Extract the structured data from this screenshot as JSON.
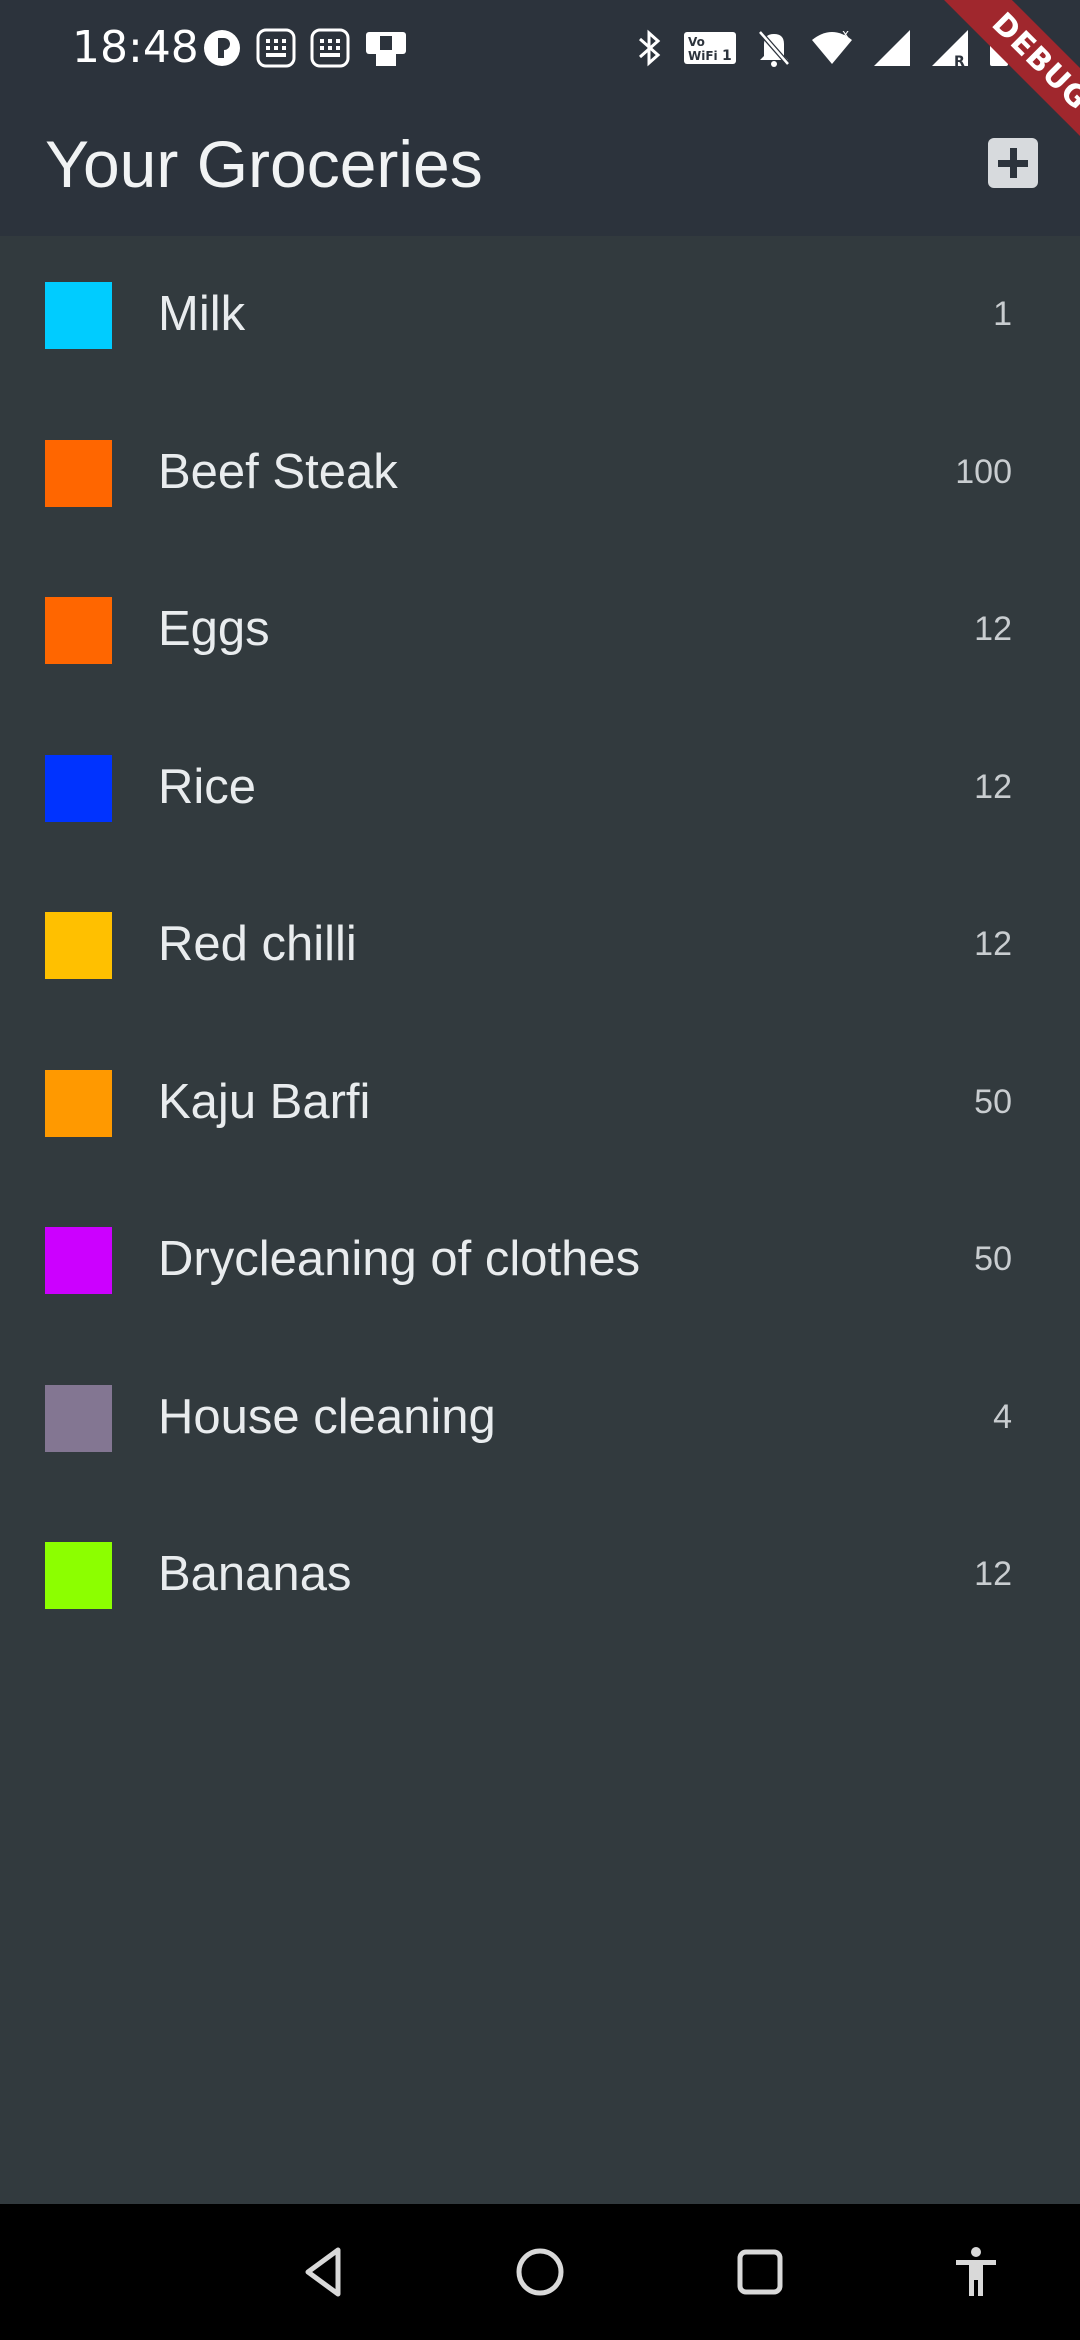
{
  "status_bar": {
    "time": "18:48",
    "left_icons": [
      "app-badge-icon",
      "notification-icon",
      "notification-icon",
      "phone-icon"
    ],
    "right_icons": [
      "bluetooth-icon",
      "vowifi-icon",
      "mute-icon",
      "wifi-icon",
      "signal-icon",
      "signal-roaming-icon",
      "battery-icon"
    ]
  },
  "debug_banner": "DEBUG",
  "app_bar": {
    "title": "Your Groceries",
    "add_icon": "plus-icon"
  },
  "groceries": [
    {
      "name": "Milk",
      "quantity": "1",
      "color": "#00CCFF"
    },
    {
      "name": "Beef Steak",
      "quantity": "100",
      "color": "#FF6600"
    },
    {
      "name": "Eggs",
      "quantity": "12",
      "color": "#FF6600"
    },
    {
      "name": "Rice",
      "quantity": "12",
      "color": "#0033FF"
    },
    {
      "name": "Red chilli",
      "quantity": "12",
      "color": "#FFC000"
    },
    {
      "name": "Kaju Barfi",
      "quantity": "50",
      "color": "#FF9900"
    },
    {
      "name": "Drycleaning of clothes",
      "quantity": "50",
      "color": "#CC00FF"
    },
    {
      "name": "House cleaning",
      "quantity": "4",
      "color": "#837692"
    },
    {
      "name": "Bananas",
      "quantity": "12",
      "color": "#8CFF00"
    }
  ],
  "nav_bar": {
    "buttons": [
      "back-icon",
      "home-icon",
      "recents-icon",
      "accessibility-icon"
    ]
  }
}
